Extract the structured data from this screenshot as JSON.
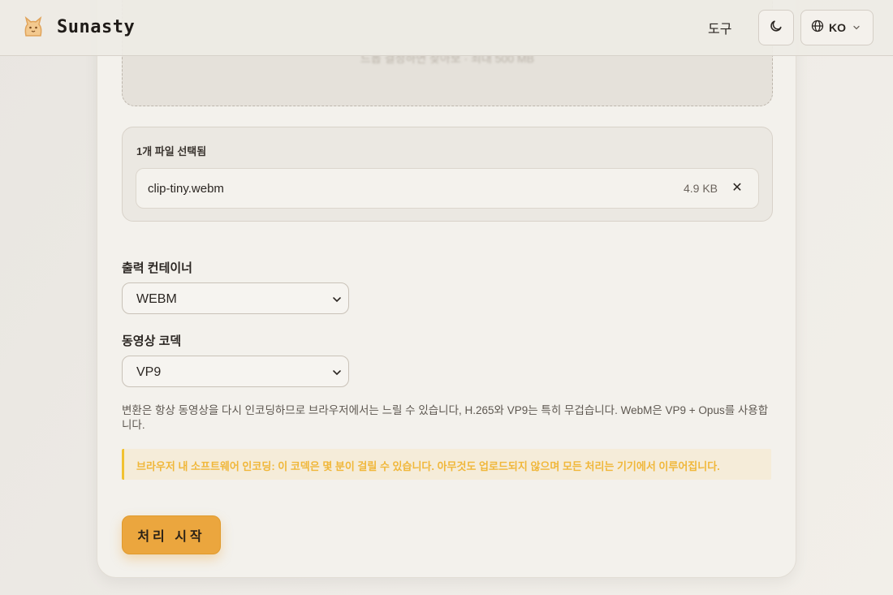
{
  "header": {
    "brand": "Sunasty",
    "nav_tools": "도구",
    "theme_icon": "moon-icon",
    "language": "KO"
  },
  "upload": {
    "hint": "드롭 결정하면 찾아보 · 최대 500 MB",
    "files_count": "1개 파일 선택됨",
    "files": [
      {
        "name": "clip-tiny.webm",
        "size": "4.9 KB",
        "remove": "✕"
      }
    ]
  },
  "options": {
    "container_label": "출력 컨테이너",
    "container_value": "WEBM",
    "codec_label": "동영상 코덱",
    "codec_value": "VP9"
  },
  "description": "변환은 항상 동영상을 다시 인코딩하므로 브라우저에서는 느릴 수 있습니다, H.265와 VP9는 특히 무겁습니다. WebM은 VP9 + Opus를 사용합니다.",
  "warning": "브라우저 내 소프트웨어 인코딩: 이 코덱은 몇 분이 걸릴 수 있습니다. 아무것도 업로드되지 않으며 모든 처리는 기기에서 이루어집니다.",
  "actions": {
    "start": "처리 시작"
  },
  "colors": {
    "accent": "#eba63e",
    "warning_text": "#f0b73a",
    "warning_border": "#f1c232"
  }
}
